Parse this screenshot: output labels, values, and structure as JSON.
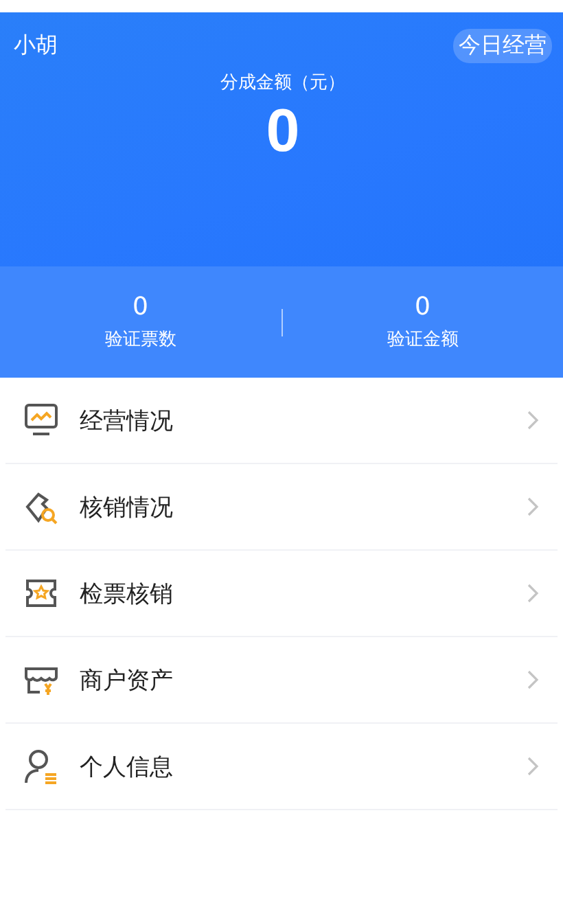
{
  "header": {
    "user_name": "小胡",
    "badge": "今日经营",
    "amount_label": "分成金额（元）",
    "amount": "0"
  },
  "stats": [
    {
      "value": "0",
      "label": "验证票数"
    },
    {
      "value": "0",
      "label": "验证金额"
    }
  ],
  "menu": [
    {
      "kind": "monitor",
      "label": "经营情况"
    },
    {
      "kind": "ticket-search",
      "label": "核销情况"
    },
    {
      "kind": "ticket-star",
      "label": "检票核销"
    },
    {
      "kind": "store",
      "label": "商户资产"
    },
    {
      "kind": "user",
      "label": "个人信息"
    }
  ]
}
